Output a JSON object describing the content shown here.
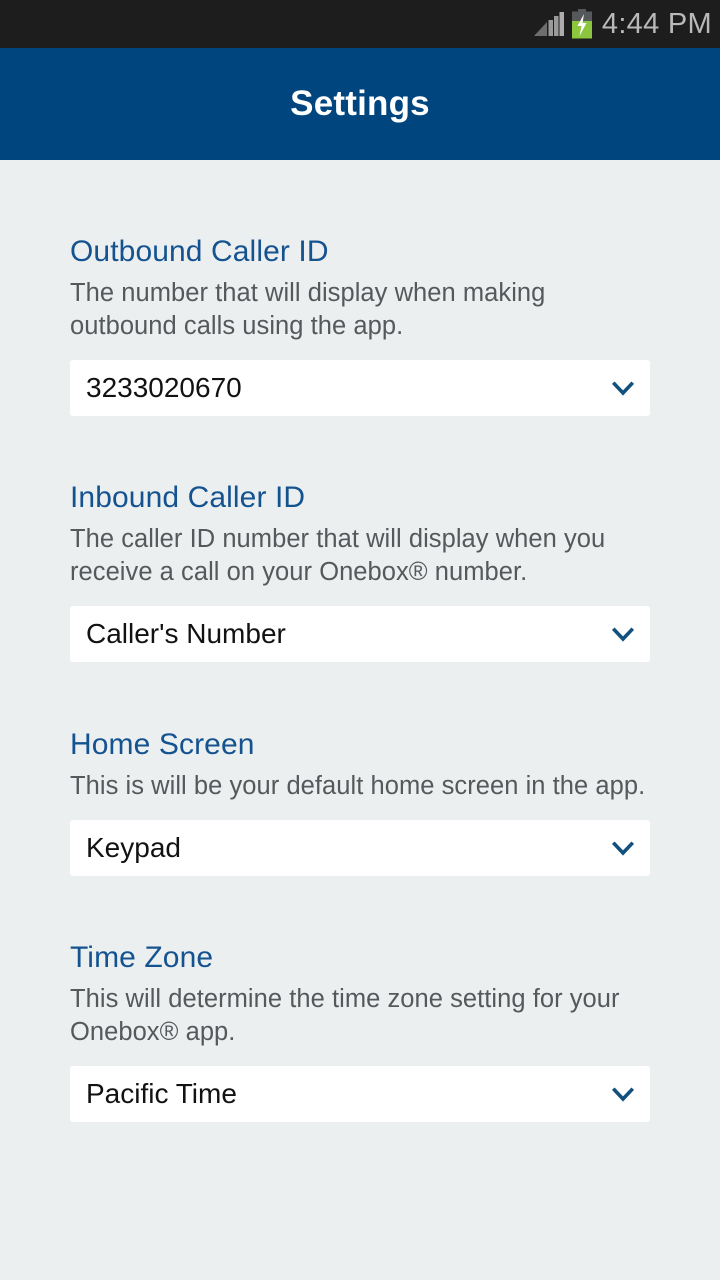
{
  "status_bar": {
    "time": "4:44 PM",
    "signal_icon": "signal-bars-icon",
    "battery_icon": "battery-charging-icon",
    "colors": {
      "background": "#1d1d1d",
      "text": "#b9b9b9",
      "battery_fill": "#8cc63e",
      "signal_bars": "#a8a8a8"
    }
  },
  "app_bar": {
    "title": "Settings",
    "background": "#00457d",
    "title_color": "#ffffff"
  },
  "theme": {
    "page_background": "#eceff0",
    "heading_blue": "#14538f",
    "description_gray": "#55595b",
    "field_background": "#ffffff",
    "value_text": "#121212",
    "chevron_blue": "#12507e"
  },
  "settings": [
    {
      "title": "Outbound Caller ID",
      "description": "The number that will display when making outbound calls using the app.",
      "value": "3233020670",
      "chevron_icon": "chevron-down-icon"
    },
    {
      "title": "Inbound Caller ID",
      "description": "The caller ID number that will display when you receive a call on your Onebox® number.",
      "value": "Caller's Number",
      "chevron_icon": "chevron-down-icon"
    },
    {
      "title": "Home Screen",
      "description": "This is will be your default home screen in the app.",
      "value": "Keypad",
      "chevron_icon": "chevron-down-icon"
    },
    {
      "title": "Time Zone",
      "description": "This will determine the time zone setting for your Onebox® app.",
      "value": "Pacific Time",
      "chevron_icon": "chevron-down-icon"
    }
  ]
}
